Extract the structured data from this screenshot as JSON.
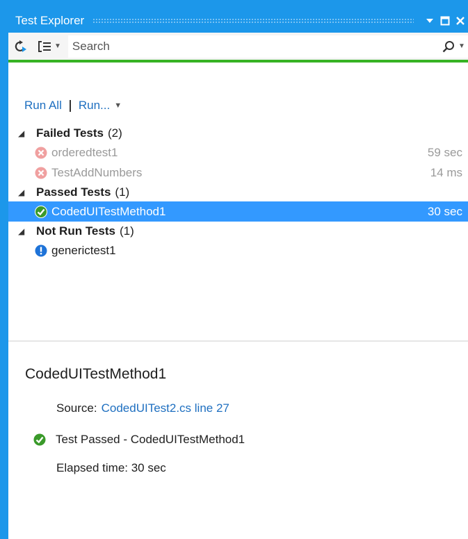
{
  "window": {
    "title": "Test Explorer"
  },
  "toolbar": {
    "search_placeholder": "Search"
  },
  "runbar": {
    "run_all": "Run All",
    "run": "Run..."
  },
  "groups": [
    {
      "name": "Failed Tests",
      "count": "(2)",
      "items": [
        {
          "name": "orderedtest1",
          "duration": "59 sec"
        },
        {
          "name": "TestAddNumbers",
          "duration": "14 ms"
        }
      ]
    },
    {
      "name": "Passed Tests",
      "count": "(1)",
      "items": [
        {
          "name": "CodedUITestMethod1",
          "duration": "30 sec"
        }
      ]
    },
    {
      "name": "Not Run Tests",
      "count": "(1)",
      "items": [
        {
          "name": "generictest1",
          "duration": ""
        }
      ]
    }
  ],
  "detail": {
    "title": "CodedUITestMethod1",
    "source_label": "Source:",
    "source_link": "CodedUITest2.cs line 27",
    "result": "Test Passed - CodedUITestMethod1",
    "elapsed": "Elapsed time: 30 sec"
  },
  "colors": {
    "accent": "#1c97ea",
    "progress": "#37b324",
    "selection": "#3399ff",
    "failed": "#f0a0a0",
    "passed": "#3a9a2a",
    "notrun": "#1e73d8"
  }
}
